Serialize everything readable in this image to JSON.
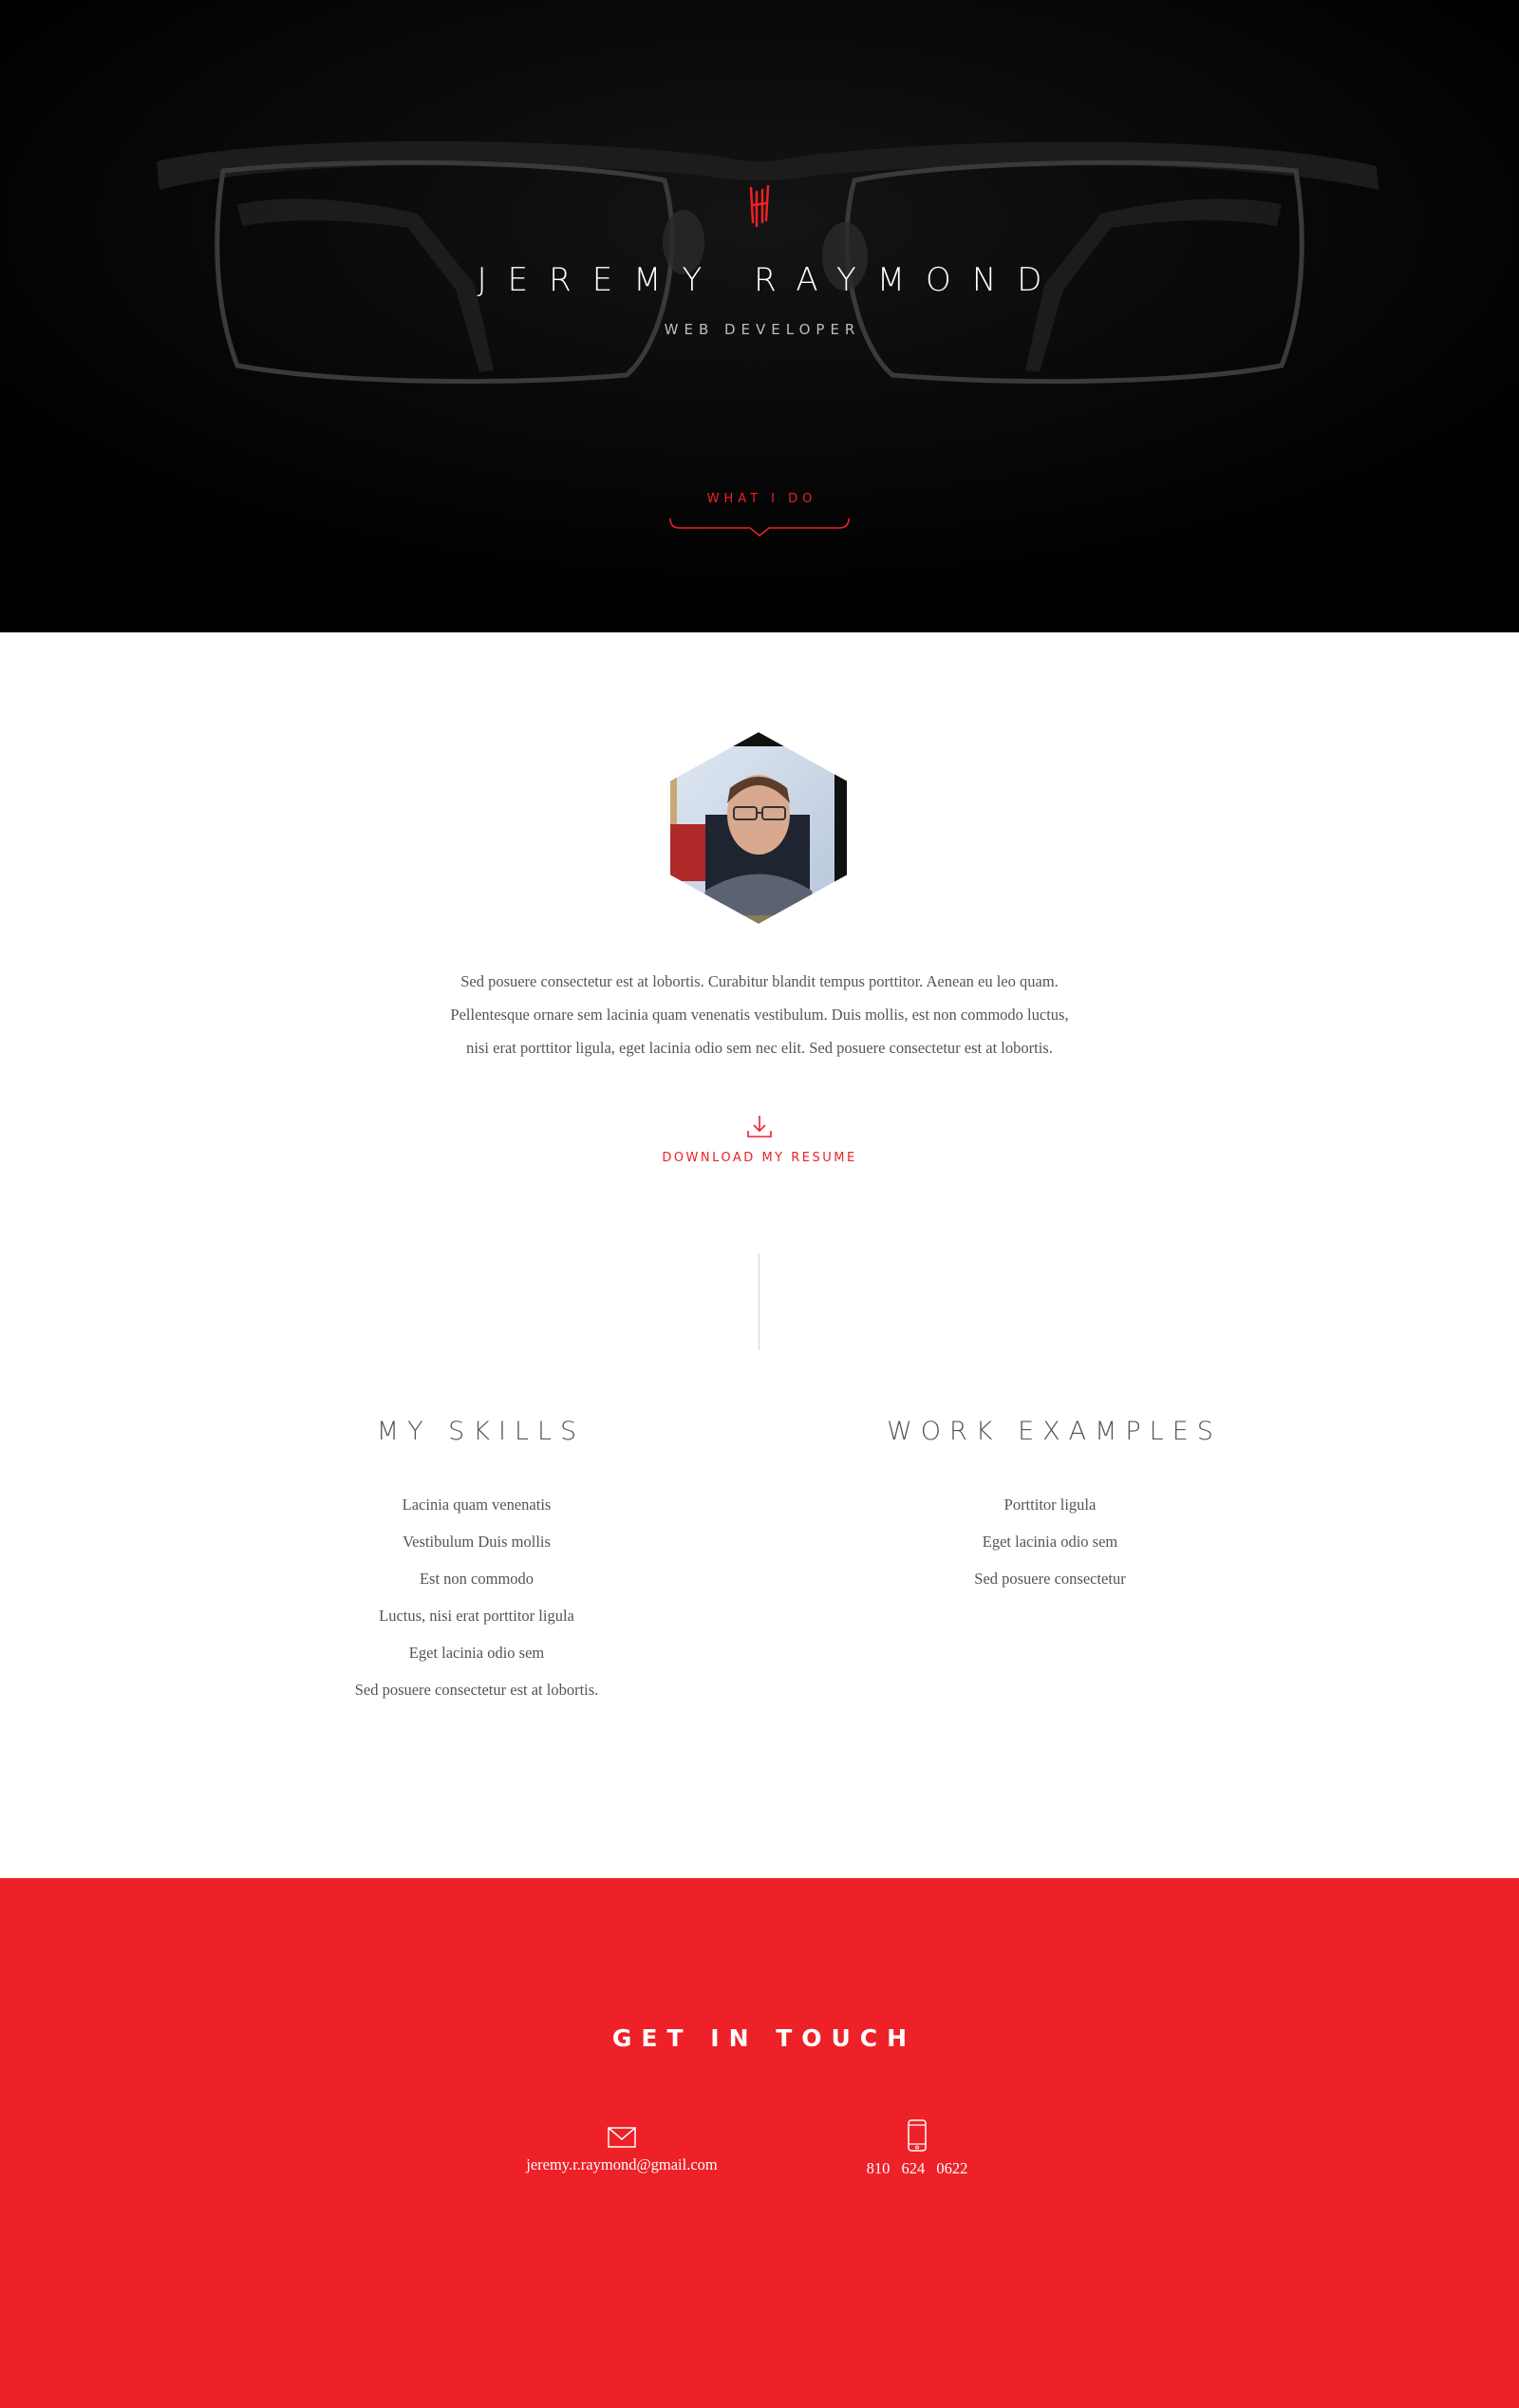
{
  "hero": {
    "name": "JEREMY RAYMOND",
    "subtitle": "WEB DEVELOPER",
    "cta_label": "WHAT I DO",
    "logo_icon": "jr-monogram-icon",
    "background_image": "eyeglasses-photo"
  },
  "about": {
    "avatar_image": "profile-photo-hexagon",
    "bio_lines": [
      "Sed posuere consectetur est at lobortis. Curabitur blandit tempus porttitor. Aenean eu leo quam.",
      "Pellentesque ornare sem lacinia quam venenatis vestibulum. Duis mollis, est non commodo luctus,",
      "nisi erat porttitor ligula, eget lacinia odio sem nec elit. Sed posuere consectetur est at lobortis."
    ],
    "download_label": "DOWNLOAD MY RESUME",
    "download_icon": "download-icon"
  },
  "skills": {
    "heading": "MY SKILLS",
    "items": [
      "Lacinia quam venenatis",
      "Vestibulum Duis mollis",
      "Est non commodo",
      "Luctus, nisi erat porttitor ligula",
      "Eget lacinia odio sem",
      "Sed posuere consectetur est at lobortis."
    ]
  },
  "work": {
    "heading": "WORK EXAMPLES",
    "items": [
      "Porttitor ligula",
      "Eget lacinia odio sem",
      "Sed posuere consectetur"
    ]
  },
  "contact": {
    "heading": "GET IN TOUCH",
    "email": "jeremy.r.raymond@gmail.com",
    "email_icon": "envelope-icon",
    "phone": "810 624 0622",
    "phone_icon": "smartphone-icon"
  },
  "colors": {
    "accent": "#ed2127",
    "hero_bg": "#000000",
    "text": "#555555"
  }
}
